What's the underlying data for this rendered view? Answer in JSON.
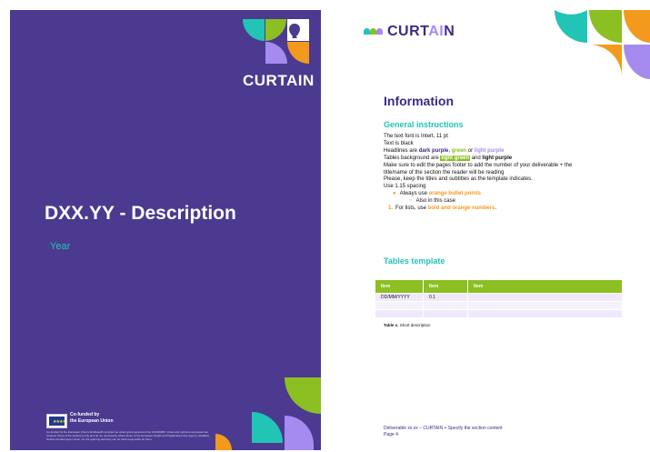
{
  "cover": {
    "title": "DXX.YY - Description",
    "year": "Year",
    "logo_text": "CURTAIN",
    "eu_label_line1": "Co-funded by",
    "eu_label_line2": "the European Union",
    "disclaimer": "Co-funded by the European Union's EU4Health programme under grant agreement No 101136486. Views and opinions expressed are however those of the author(s) only and do not necessarily reflect those of the European Health and Digital Executive Agency (HaDEA). Neither the European Union nor the granting authority can be held responsible for them."
  },
  "content": {
    "logo": {
      "prefix": "CURT",
      "accent": "AI",
      "suffix": "N"
    },
    "heading_information": "Information",
    "heading_general": "General instructions",
    "lines": {
      "font": "The text font is Intert, 11 pt",
      "text_black": "Text is black",
      "headlines_prefix": "Headlines are ",
      "headlines_dark_purple": "dark purple",
      "headlines_sep1": ", ",
      "headlines_green": "green",
      "headlines_sep2": " or ",
      "headlines_light_purple": "light purple",
      "tables_prefix": "Tables background are ",
      "tables_light_green": "light green",
      "tables_and": " and ",
      "tables_light_purple": "light purple",
      "footer_line1": "Make sure to edit the pages footer to add the number of your deliverable + the",
      "footer_line2": "title/name of the section the reader will be reading",
      "keep_titles": "Please, keep the titles and subtitles as the template indicates.",
      "spacing": "Use 1.15 spacing",
      "bullet_prefix": "Always use ",
      "bullet_orange": "orange bullet points",
      "sub_bullet": "Also in this case",
      "numbered_prefix": "For lists, use ",
      "numbered_bold": "bold and orange numbers",
      "numbered_suffix": "."
    },
    "heading_tables": "Tables template",
    "table": {
      "headers": [
        "Item",
        "Item",
        "Item"
      ],
      "rows": [
        [
          "DD/MM/YYYY",
          "0.1",
          ""
        ],
        [
          "",
          "",
          ""
        ],
        [
          "",
          "",
          ""
        ]
      ]
    },
    "table_caption_bold": "Table x.",
    "table_caption_text": " Short description",
    "footer_line1": "Deliverable xx.xx – CURTAIN + Specify the section content",
    "footer_line2": "Page 4"
  },
  "colors": {
    "dark_purple": "#4b3a8f",
    "teal": "#22c4b5",
    "green": "#8bbf22",
    "light_purple": "#a58bf0",
    "orange": "#f39a1e"
  }
}
